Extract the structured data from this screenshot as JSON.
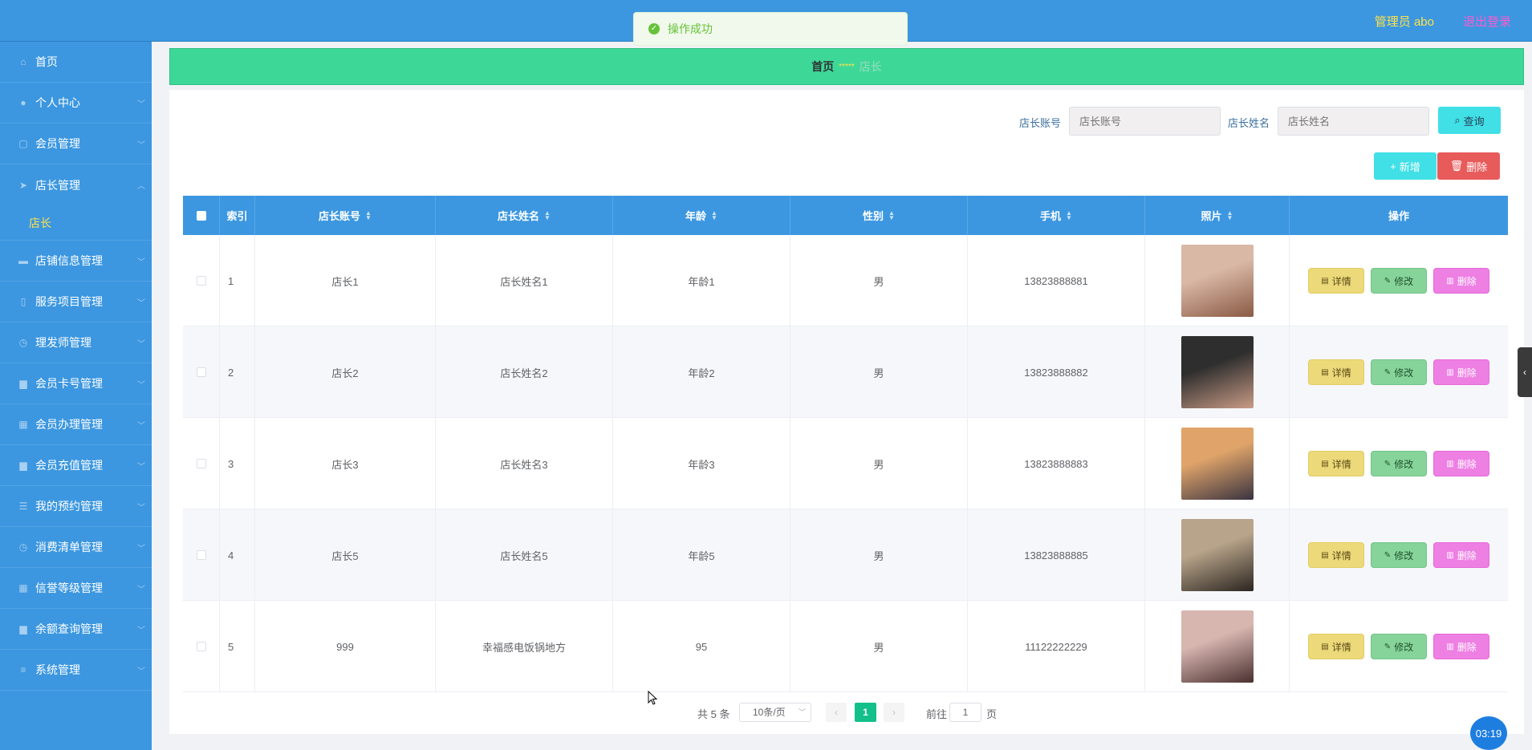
{
  "topbar": {
    "admin_label": "管理员 abo",
    "logout_label": "退出登录"
  },
  "toast": {
    "message": "操作成功"
  },
  "sidebar": {
    "items": [
      {
        "label": "首页",
        "icon": "home-icon"
      },
      {
        "label": "个人中心",
        "icon": "user-icon"
      },
      {
        "label": "会员管理",
        "icon": "copy-icon"
      },
      {
        "label": "店长管理",
        "icon": "navigation-icon",
        "expanded": true,
        "sub": "店长"
      },
      {
        "label": "店铺信息管理",
        "icon": "comment-icon"
      },
      {
        "label": "服务项目管理",
        "icon": "mobile-icon"
      },
      {
        "label": "理发师管理",
        "icon": "clock-icon"
      },
      {
        "label": "会员卡号管理",
        "icon": "briefcase-icon"
      },
      {
        "label": "会员办理管理",
        "icon": "grid-icon"
      },
      {
        "label": "会员充值管理",
        "icon": "briefcase-icon"
      },
      {
        "label": "我的预约管理",
        "icon": "sliders-icon"
      },
      {
        "label": "消费清单管理",
        "icon": "clock-icon"
      },
      {
        "label": "信誉等级管理",
        "icon": "grid-icon"
      },
      {
        "label": "余额查询管理",
        "icon": "box-icon"
      },
      {
        "label": "系统管理",
        "icon": "list-icon"
      }
    ]
  },
  "breadcrumb": {
    "home": "首页",
    "stars": "*****",
    "current": "店长"
  },
  "search": {
    "account_label": "店长账号",
    "account_placeholder": "店长账号",
    "name_label": "店长姓名",
    "name_placeholder": "店长姓名",
    "query_label": "查询"
  },
  "toolbar": {
    "add_label": "新增",
    "delete_label": "删除"
  },
  "table": {
    "headers": [
      "索引",
      "店长账号",
      "店长姓名",
      "年龄",
      "性别",
      "手机",
      "照片",
      "操作"
    ],
    "rows": [
      {
        "index": "1",
        "account": "店长1",
        "name": "店长姓名1",
        "age": "年龄1",
        "gender": "男",
        "phone": "13823888881"
      },
      {
        "index": "2",
        "account": "店长2",
        "name": "店长姓名2",
        "age": "年龄2",
        "gender": "男",
        "phone": "13823888882"
      },
      {
        "index": "3",
        "account": "店长3",
        "name": "店长姓名3",
        "age": "年龄3",
        "gender": "男",
        "phone": "13823888883"
      },
      {
        "index": "4",
        "account": "店长5",
        "name": "店长姓名5",
        "age": "年龄5",
        "gender": "男",
        "phone": "13823888885"
      },
      {
        "index": "5",
        "account": "999",
        "name": "幸福感电饭锅地方",
        "age": "95",
        "gender": "男",
        "phone": "11122222229"
      }
    ],
    "actions": {
      "detail": "详情",
      "edit": "修改",
      "delete": "删除"
    }
  },
  "pagination": {
    "total": "共 5 条",
    "page_size": "10条/页",
    "current_page": "1",
    "goto_label": "前往",
    "goto_value": "1",
    "page_suffix": "页"
  },
  "clock": "03:19",
  "colors": {
    "header": "#3c97e0",
    "breadcrumb": "#3dd898",
    "accent": "#13c08a"
  }
}
